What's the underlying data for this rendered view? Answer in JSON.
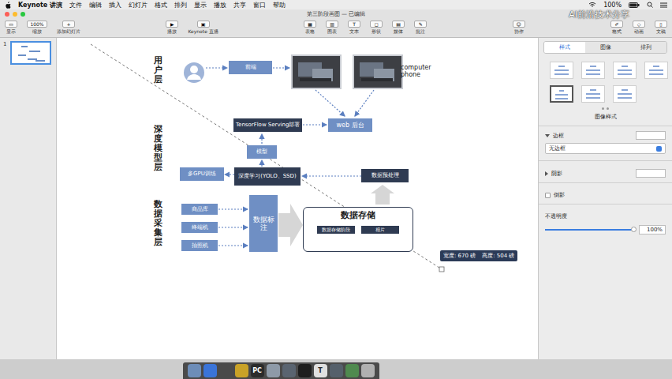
{
  "menu_bar": {
    "app": "Keynote 讲演",
    "items": [
      "文件",
      "编辑",
      "插入",
      "幻灯片",
      "格式",
      "排列",
      "显示",
      "播放",
      "共享",
      "窗口",
      "帮助"
    ],
    "battery": "100%"
  },
  "watermark": "AI前沿技术分享",
  "window": {
    "title": "第三阶段画图 — 已编辑"
  },
  "toolbar": {
    "items": [
      {
        "label": "显示"
      },
      {
        "label": "缩放",
        "value": "100%"
      },
      {
        "label": "添加幻灯片"
      },
      {
        "label": "播放"
      },
      {
        "label": "Keynote 直播"
      },
      {
        "label": "表格"
      },
      {
        "label": "图表"
      },
      {
        "label": "文本"
      },
      {
        "label": "形状"
      },
      {
        "label": "媒体"
      },
      {
        "label": "批注"
      },
      {
        "label": "协作"
      },
      {
        "label": "格式"
      },
      {
        "label": "动画"
      },
      {
        "label": "文稿"
      }
    ]
  },
  "navigator": {
    "slides": [
      {
        "number": "1",
        "selected": true
      }
    ]
  },
  "diagram": {
    "layers": [
      {
        "text": "用户层"
      },
      {
        "text": "深度模型层"
      },
      {
        "text": "数据采集层"
      }
    ],
    "nodes": [
      {
        "kind": "person"
      },
      {
        "kind": "blue",
        "text": "前端"
      },
      {
        "kind": "photo"
      },
      {
        "kind": "photo"
      },
      {
        "kind": "caption",
        "text": "computer\nphone"
      },
      {
        "kind": "navy",
        "text": "TensorFlow Serving部署"
      },
      {
        "kind": "web",
        "text": "web 后台"
      },
      {
        "kind": "blue",
        "text": "模型"
      },
      {
        "kind": "blue",
        "text": "多GPU训练"
      },
      {
        "kind": "navy",
        "text": "深度学习(YOLO、SSD)"
      },
      {
        "kind": "navy",
        "text": "数据预处理"
      },
      {
        "kind": "blue",
        "text": "商品库"
      },
      {
        "kind": "blue",
        "text": "终端机"
      },
      {
        "kind": "blue",
        "text": "拍照机"
      },
      {
        "kind": "tall",
        "text": "数据标注"
      },
      {
        "kind": "container",
        "text": "数据存储",
        "children": [
          {
            "text": "数据存储阶段"
          },
          {
            "text": "相片"
          }
        ]
      }
    ]
  },
  "selection": {
    "width": "宽度: 670 磅",
    "height": "高度: 504 磅"
  },
  "inspector": {
    "tabs": [
      {
        "label": "样式",
        "selected": true
      },
      {
        "label": "图像",
        "selected": false
      },
      {
        "label": "排列",
        "selected": false
      }
    ],
    "presets": [
      {
        "selected": false
      },
      {
        "selected": false
      },
      {
        "selected": false
      },
      {
        "selected": false
      },
      {
        "selected": true
      },
      {
        "selected": false
      },
      {
        "selected": false
      }
    ],
    "presets_title": "图像样式",
    "border": {
      "label": "边框",
      "expanded": true,
      "value": "无边框"
    },
    "shadow": {
      "label": "阴影",
      "expanded": false
    },
    "reflection": {
      "label": "倒影",
      "checked": false
    },
    "opacity": {
      "label": "不透明度",
      "level": 1,
      "reading": "100%"
    }
  },
  "dock": {
    "items": [
      {
        "color": "#6d8db8"
      },
      {
        "color": "#3a74d8"
      },
      {
        "color": "#4a4a4a"
      },
      {
        "color": "#c9a227"
      },
      {
        "color": "#2b2b2b",
        "label": "PC"
      },
      {
        "color": "#8e9aa8"
      },
      {
        "color": "#5a6470"
      },
      {
        "color": "#1e1e1e"
      },
      {
        "color": "#e0e0e0",
        "label": "T"
      },
      {
        "color": "#55606b"
      },
      {
        "color": "#4f8a4f"
      },
      {
        "color": "#b0b0b0"
      }
    ]
  }
}
